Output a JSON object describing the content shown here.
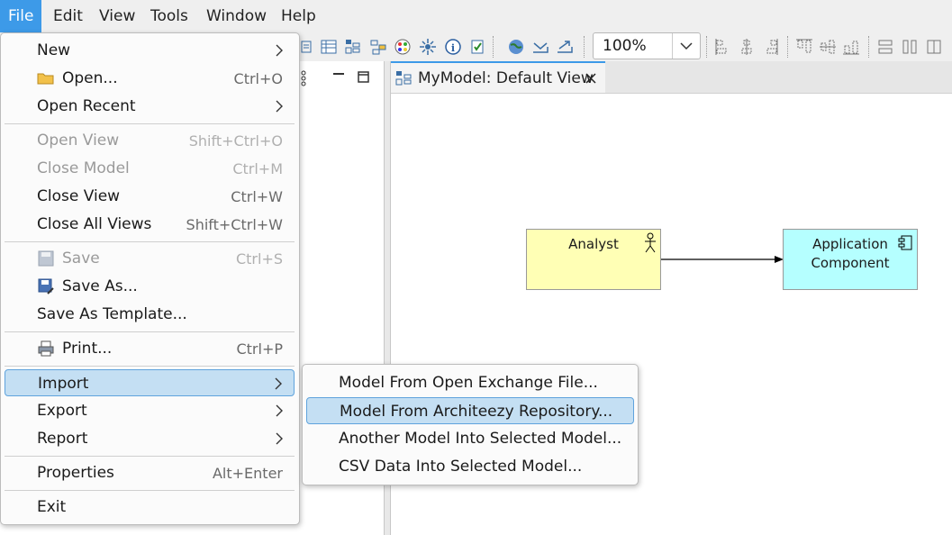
{
  "menubar": {
    "items": [
      {
        "label": "File",
        "active": true
      },
      {
        "label": "Edit"
      },
      {
        "label": "View"
      },
      {
        "label": "Tools"
      },
      {
        "label": "Window"
      },
      {
        "label": "Help"
      }
    ]
  },
  "toolbar": {
    "zoom_value": "100%"
  },
  "editor": {
    "tab_label": "MyModel: Default View",
    "nodes": {
      "analyst": "Analyst",
      "app_line1": "Application",
      "app_line2": "Component"
    }
  },
  "file_menu": {
    "new": "New",
    "open": "Open...",
    "open_acc": "Ctrl+O",
    "open_recent": "Open Recent",
    "open_view": "Open View",
    "open_view_acc": "Shift+Ctrl+O",
    "close_model": "Close Model",
    "close_model_acc": "Ctrl+M",
    "close_view": "Close View",
    "close_view_acc": "Ctrl+W",
    "close_all_views": "Close All Views",
    "close_all_views_acc": "Shift+Ctrl+W",
    "save": "Save",
    "save_acc": "Ctrl+S",
    "save_as": "Save As...",
    "save_as_template": "Save As Template...",
    "print": "Print...",
    "print_acc": "Ctrl+P",
    "import": "Import",
    "export": "Export",
    "report": "Report",
    "properties": "Properties",
    "properties_acc": "Alt+Enter",
    "exit": "Exit"
  },
  "import_menu": {
    "items": [
      "Model From Open Exchange File...",
      "Model From Architeezy Repository...",
      "Another Model Into Selected Model...",
      "CSV Data Into Selected Model..."
    ]
  },
  "colors": {
    "accent": "#3d9ae8",
    "highlight": "#c4dff3",
    "actor_fill": "#ffffb5",
    "component_fill": "#b5ffff"
  }
}
